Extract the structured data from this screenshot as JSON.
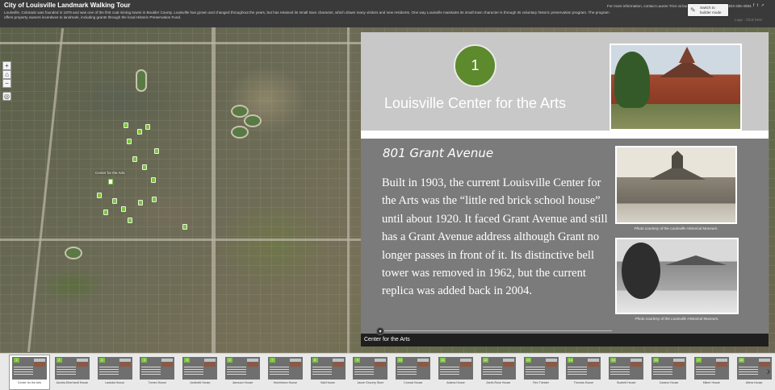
{
  "header": {
    "title": "City of Louisville Landmark Walking Tour",
    "description": "Louisville, Colorado was founded in 1878 and was one of the first coal mining towns in Boulder County. Louisville has grown and changed throughout the years, but has retained its small town character, which draws many visitors and new residents. One way Louisville maintains its small town character is through its voluntary historic preservation program. The program offers property owners incentives to landmark, including grants through the local Historic Preservation Fund.",
    "contact": "For more information, contact Lauren Trice at lau",
    "contact_suffix": "303-335-4594.",
    "builder_button": "Switch to builder mode",
    "social": "f  t  ↗",
    "logo_alt": "Logo - Click here"
  },
  "map": {
    "zoom_in": "+",
    "home": "⌂",
    "zoom_out": "−",
    "locate": "◎",
    "center_label": "Center for the Arts",
    "caption": "Center for the Arts",
    "collapse": "▾"
  },
  "story": {
    "number": "1",
    "title": "Louisville Center for the Arts",
    "address": "801 Grant Avenue",
    "body": "Built in 1903, the current Louisville Center for the Arts was the “little red brick school house” until about 1920. It faced Grant Avenue and still has a Grant Avenue address although Grant no longer passes in front of it. Its distinctive bell tower was removed in 1962, but the current replica was added back in 2004.",
    "caption_a": "Photo courtesy of the Louisville Historical Museum.",
    "caption_b": "Photo courtesy of the Louisville Historical Museum."
  },
  "carousel": {
    "next_arrow": "›",
    "items": [
      {
        "num": "1",
        "label": "Center for the Arts"
      },
      {
        "num": "2",
        "label": "Jacobs-Eberhardt House"
      },
      {
        "num": "3",
        "label": "Lastoka House"
      },
      {
        "num": "4",
        "label": "Tomeo House"
      },
      {
        "num": "5",
        "label": "Jordinelli House"
      },
      {
        "num": "6",
        "label": "Jannucci House"
      },
      {
        "num": "7",
        "label": "Hutchinson House"
      },
      {
        "num": "8",
        "label": "Ball House"
      },
      {
        "num": "9",
        "label": "Jacoe Grocery Store"
      },
      {
        "num": "10",
        "label": "Conrad House"
      },
      {
        "num": "11",
        "label": "Adams House"
      },
      {
        "num": "12",
        "label": "Zarini-Rose House"
      },
      {
        "num": "13",
        "label": "Rex Theater"
      },
      {
        "num": "14",
        "label": "Thomas House"
      },
      {
        "num": "15",
        "label": "Scarlett House"
      },
      {
        "num": "16",
        "label": "Caranci House"
      },
      {
        "num": "17",
        "label": "Milner House"
      },
      {
        "num": "18",
        "label": "Allera House"
      }
    ]
  }
}
